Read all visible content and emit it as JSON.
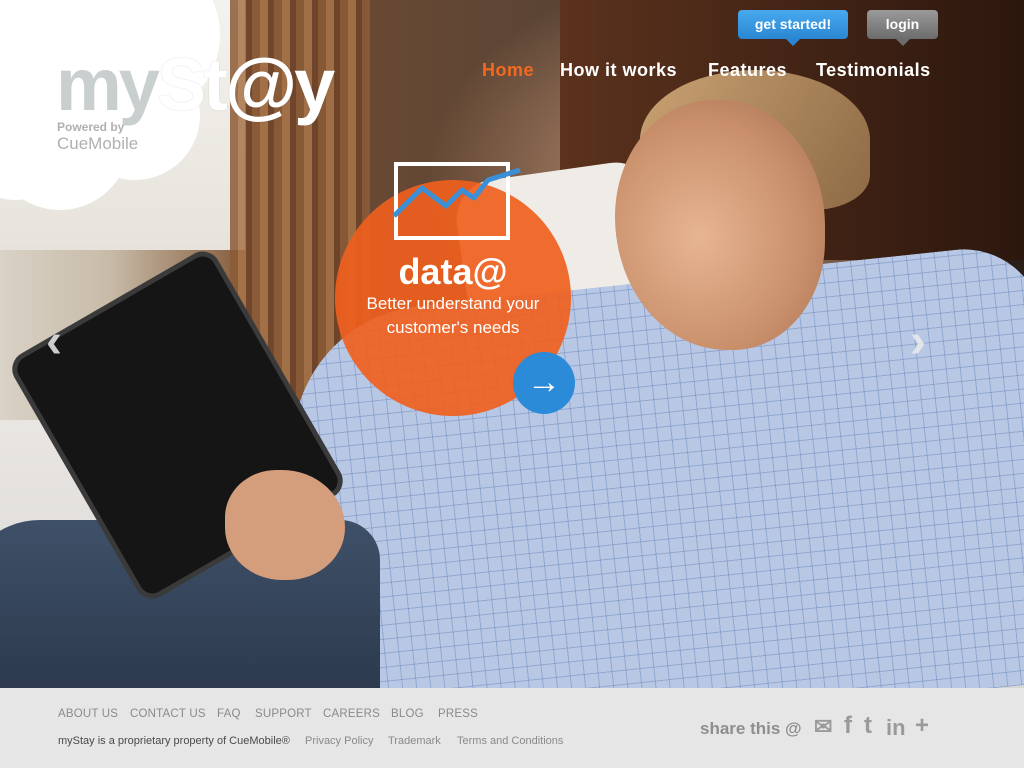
{
  "logo": {
    "part1": "my",
    "part2": "St@y",
    "powered": "Powered by",
    "brand": "CueMobile"
  },
  "top_buttons": {
    "get_started": "get started!",
    "login": "login"
  },
  "nav": [
    {
      "label": "Home",
      "active": true
    },
    {
      "label": "How it works",
      "active": false
    },
    {
      "label": "Features",
      "active": false
    },
    {
      "label": "Testimonials",
      "active": false
    }
  ],
  "hero": {
    "prev_arrow": "‹",
    "next_arrow": "›",
    "feature": {
      "title": "data@",
      "subtitle": "Better understand your customer's needs",
      "go_arrow": "→",
      "chart_icon": "line-chart-icon"
    }
  },
  "footer": {
    "links": [
      "ABOUT US",
      "CONTACT US",
      "FAQ",
      "SUPPORT",
      "CAREERS",
      "BLOG",
      "PRESS"
    ],
    "copyright": "myStay is a proprietary property of CueMobile®",
    "legal_links": [
      "Privacy Policy",
      "Trademark",
      "Terms and Conditions"
    ],
    "share_label": "share this @",
    "share_icons": {
      "email": "✉",
      "facebook": "f",
      "twitter": "t",
      "linkedin": "in",
      "plus": "+"
    }
  },
  "colors": {
    "accent_orange": "#f26a21",
    "accent_blue": "#2c8bd8",
    "login_gray": "#7a7a7a",
    "footer_bg": "#e6e6e6"
  }
}
